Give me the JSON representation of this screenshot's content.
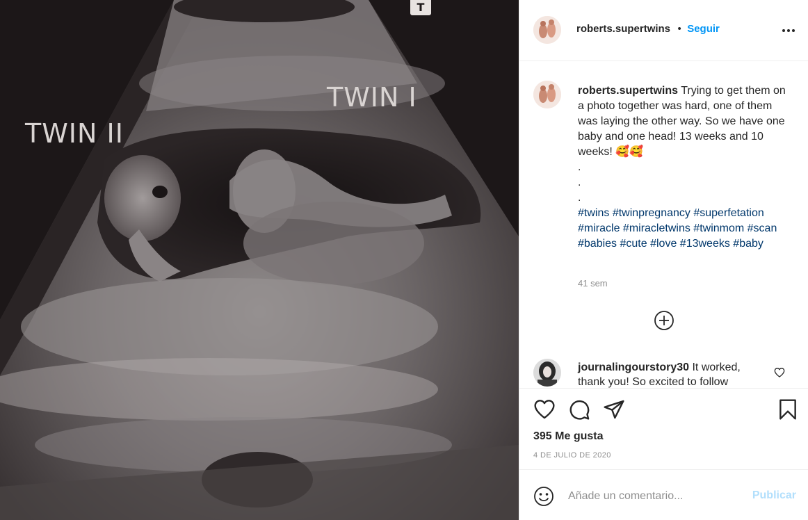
{
  "media": {
    "labels": [
      "TWIN II",
      "TWIN I"
    ],
    "corner_mark": "T"
  },
  "header": {
    "username": "roberts.supertwins",
    "separator": "•",
    "follow_label": "Seguir"
  },
  "caption": {
    "username": "roberts.supertwins",
    "text": "Trying to get them on a photo together was hard, one of them was laying the other way. So we have one baby and one head! 13 weeks and 10 weeks! 🥰🥰",
    "dots": [
      ".",
      ".",
      "."
    ],
    "hashtags": [
      "#twins",
      "#twinpregnancy",
      "#superfetation",
      "#miracle",
      "#miracletwins",
      "#twinmom",
      "#scan",
      "#babies",
      "#cute",
      "#love",
      "#13weeks",
      "#baby"
    ],
    "time": "41 sem"
  },
  "comment": {
    "username": "journalingourstory30",
    "text": "It worked, thank you! So excited to follow"
  },
  "actions": {
    "icons": [
      "heart-icon",
      "comment-icon",
      "share-icon",
      "bookmark-icon"
    ],
    "likes": "395 Me gusta",
    "date": "4 DE JULIO DE 2020"
  },
  "add_comment": {
    "placeholder": "Añade un comentario...",
    "post_label": "Publicar"
  }
}
